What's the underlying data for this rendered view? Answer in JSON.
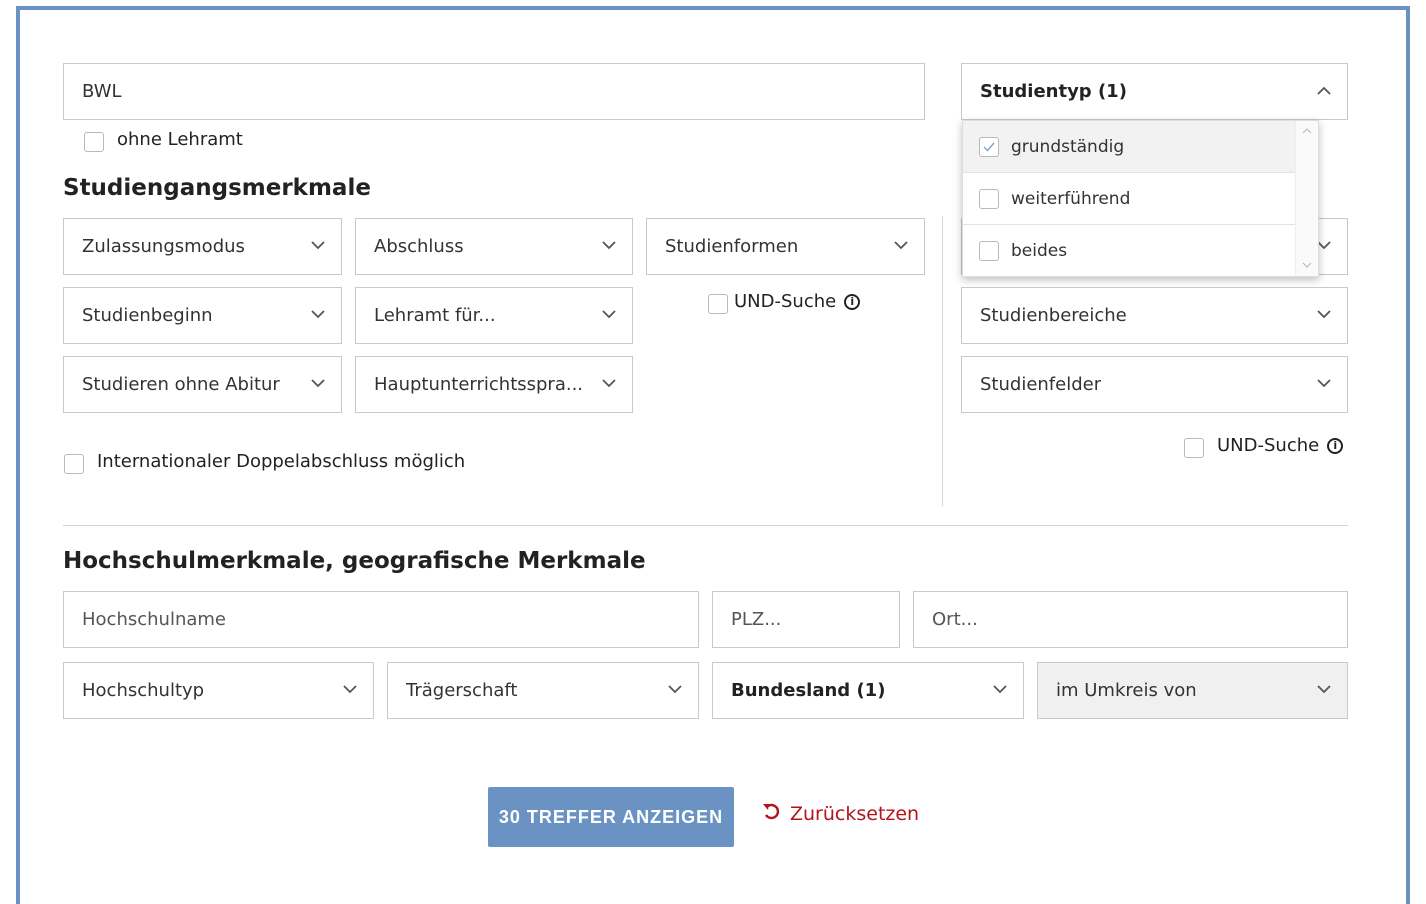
{
  "search": {
    "value": "BWL"
  },
  "ohne_lehramt": {
    "label": "ohne Lehramt"
  },
  "studiengang": {
    "heading": "Studiengangsmerkmale",
    "selects": [
      {
        "label": "Zulassungsmodus"
      },
      {
        "label": "Abschluss"
      },
      {
        "label": "Studienformen"
      },
      {
        "label": "Studienbeginn"
      },
      {
        "label": "Lehramt für..."
      },
      {
        "label": "Studieren ohne Abitur"
      },
      {
        "label": "Hauptunterrichtsspra..."
      }
    ],
    "und_suche": "UND-Suche",
    "doppelabschluss": "Internationaler Doppelabschluss möglich"
  },
  "studientyp": {
    "label": "Studientyp (1)",
    "options": [
      {
        "label": "grundständig",
        "checked": true
      },
      {
        "label": "weiterführend",
        "checked": false
      },
      {
        "label": "beides",
        "checked": false
      }
    ]
  },
  "right_selects": [
    {
      "label": "Studienbereiche"
    },
    {
      "label": "Studienfelder"
    }
  ],
  "right_und_suche": "UND-Suche",
  "hochschule": {
    "heading": "Hochschulmerkmale, geografische Merkmale",
    "name_placeholder": "Hochschulname",
    "plz_placeholder": "PLZ...",
    "ort_placeholder": "Ort...",
    "hochschultyp": "Hochschultyp",
    "traegerschaft": "Trägerschaft",
    "bundesland": "Bundesland (1)",
    "umkreis": "im Umkreis von"
  },
  "actions": {
    "submit": "30 TREFFER ANZEIGEN",
    "reset": "Zurücksetzen"
  },
  "colors": {
    "accent": "#6a93c3",
    "reset": "#b3131b"
  }
}
